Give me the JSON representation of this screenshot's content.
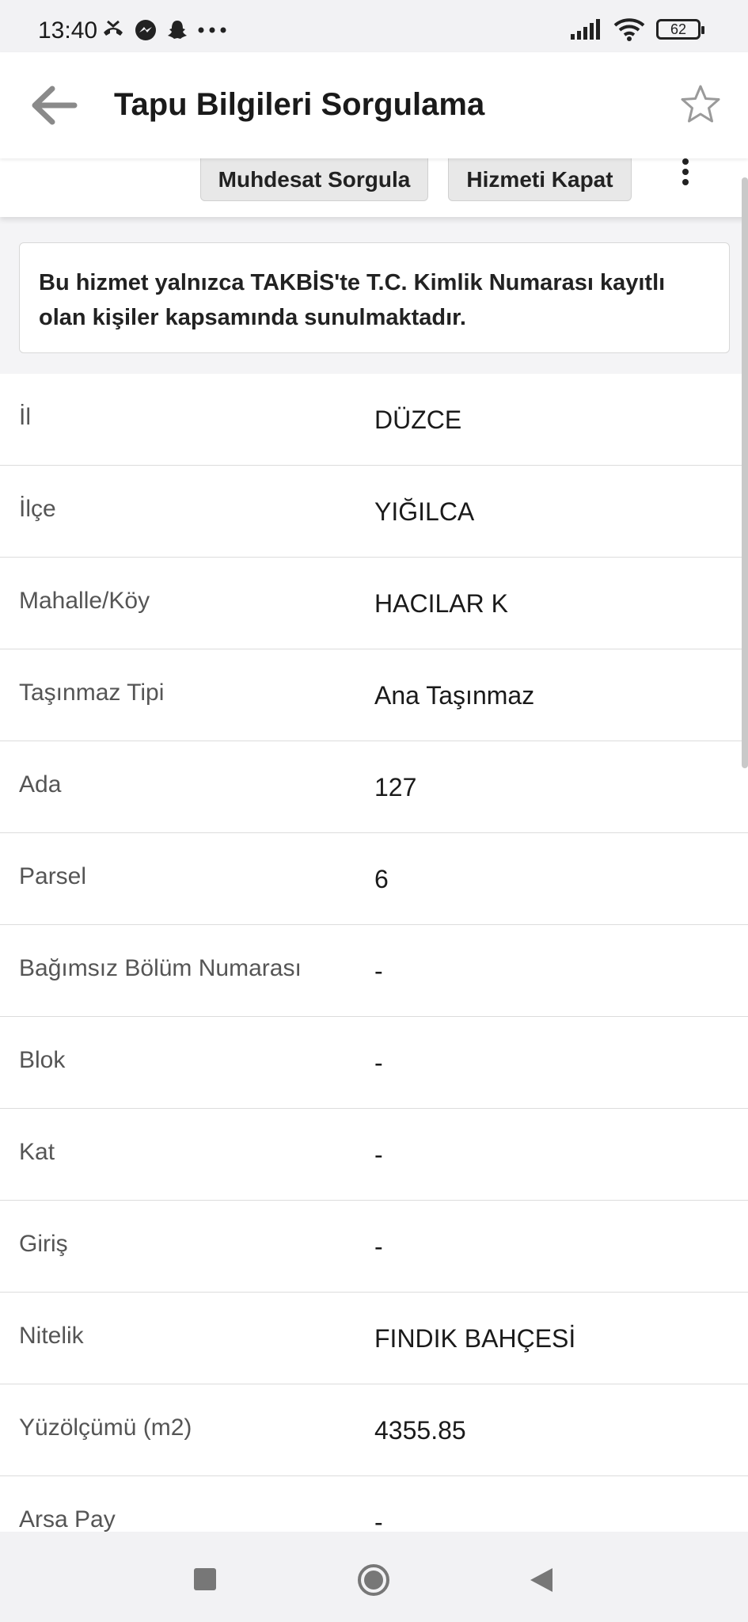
{
  "status_bar": {
    "time": "13:40",
    "battery": "62",
    "left_icons": [
      "missed-call-icon",
      "messenger-icon",
      "snapchat-icon",
      "more-dots-icon"
    ],
    "right_icons": [
      "signal-icon",
      "wifi-icon",
      "battery-icon"
    ]
  },
  "header": {
    "title": "Tapu Bilgileri Sorgulama",
    "back_icon": "back-arrow-icon",
    "favorite_icon": "star-icon"
  },
  "actions": {
    "muhdesat_label": "Muhdesat Sorgula",
    "kapat_label": "Hizmeti Kapat",
    "more_icon": "vertical-dots-icon"
  },
  "notice": {
    "text": "Bu hizmet yalnızca TAKBİS'te T.C. Kimlik Numarası kayıtlı olan kişiler kapsamında sunulmaktadır."
  },
  "rows": [
    {
      "label": "İl",
      "value": "DÜZCE"
    },
    {
      "label": "İlçe",
      "value": "YIĞILCA"
    },
    {
      "label": "Mahalle/Köy",
      "value": "HACILAR K"
    },
    {
      "label": "Taşınmaz Tipi",
      "value": "Ana Taşınmaz"
    },
    {
      "label": "Ada",
      "value": "127"
    },
    {
      "label": "Parsel",
      "value": "6"
    },
    {
      "label": "Bağımsız Bölüm Numarası",
      "value": "-"
    },
    {
      "label": "Blok",
      "value": "-"
    },
    {
      "label": "Kat",
      "value": "-"
    },
    {
      "label": "Giriş",
      "value": "-"
    },
    {
      "label": "Nitelik",
      "value": "FINDIK BAHÇESİ"
    },
    {
      "label": "Yüzölçümü (m2)",
      "value": "4355.85"
    },
    {
      "label": "Arsa Pay",
      "value": "-"
    }
  ],
  "nav": {
    "recents_icon": "square-icon",
    "home_icon": "home-circle-icon",
    "back_icon": "back-triangle-icon"
  }
}
